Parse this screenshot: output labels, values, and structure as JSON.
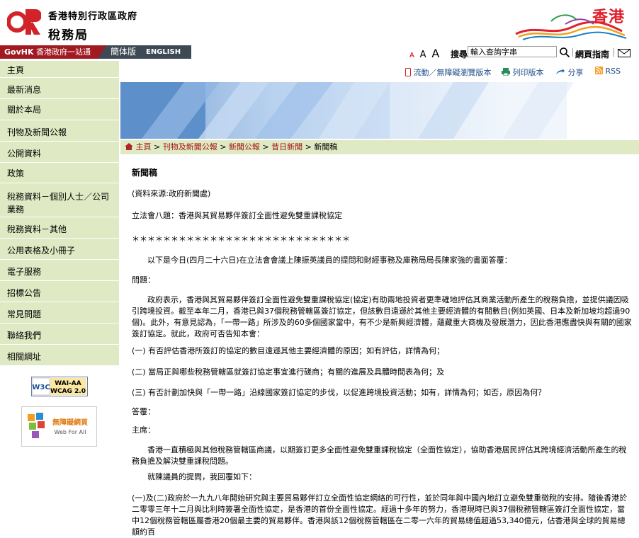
{
  "header": {
    "gov_name": "香港特別行政區政府",
    "dept_name": "稅務局",
    "brand_text": "香港"
  },
  "topbar": {
    "govhk_prefix": "GovHK",
    "govhk_text": "香港政府一站通",
    "lang_sc": "簡体版",
    "lang_en": "ENGLISH",
    "font_small": "A",
    "font_mid": "A",
    "font_large": "A",
    "search_label": "搜尋",
    "search_value": "輸入查詢字串",
    "sitemap": "網頁指南"
  },
  "sidebar": {
    "items": [
      {
        "label": "主頁"
      },
      {
        "label": "最新消息"
      },
      {
        "label": "關於本局"
      },
      {
        "label": "刊物及新聞公報"
      },
      {
        "label": "公開資料"
      },
      {
        "label": "政策"
      },
      {
        "label": "稅務資料－個別人士／公司業務"
      },
      {
        "label": "稅務資料－其他"
      },
      {
        "label": "公用表格及小冊子"
      },
      {
        "label": "電子服務"
      },
      {
        "label": "招標公告"
      },
      {
        "label": "常見問題"
      },
      {
        "label": "聯絡我們"
      },
      {
        "label": "相關網址"
      }
    ],
    "w3c_text": "W3C",
    "wai_text": "WAI-AA",
    "wcag_text": "WCAG 2.0",
    "wfa_text1": "無障礙網頁",
    "wfa_text2": "Web For All"
  },
  "tools": {
    "mobile": "流動／無障礙瀏覽版本",
    "print": "列印版本",
    "share": "分享",
    "rss": "RSS"
  },
  "breadcrumb": {
    "home": "主頁",
    "c1": "刊物及新聞公報",
    "c2": "新聞公報",
    "c3": "昔日新聞",
    "current": "新聞稿"
  },
  "article": {
    "title": "新聞稿",
    "source": "(資料來源:政府新聞處)",
    "heading": "立法會八題：香港與其貿易夥伴簽訂全面性避免雙重課稅協定",
    "stars": "＊＊＊＊＊＊＊＊＊＊＊＊＊＊＊＊＊＊＊＊＊＊＊＊＊＊＊＊",
    "intro": "以下是今日(四月二十六日)在立法會會議上陳振英議員的提問和財經事務及庫務局局長陳家強的書面答覆：",
    "q_label": "問題：",
    "q_body": "政府表示，香港與其貿易夥伴簽訂全面性避免雙重課稅協定(協定)有助兩地投資者更準確地評估其商業活動所產生的稅務負擔，並提供議因吸引跨境投資。截至本年二月，香港已與37個稅務管轄區簽訂協定，但該數目遠遜於其他主要經濟體的有關數目(例如英國、日本及新加坡均超過90個)。此外，有意見認為，「一帶一路」所涉及的60多個國家當中，有不少是新興經濟體，蘊藏重大商機及發展潛力，因此香港應盡快與有關的國家簽訂協定。就此，政府可否告知本會：",
    "q1": "(一) 有否評估香港所簽訂的協定的數目遠遜其他主要經濟體的原因；如有評估，詳情為何；",
    "q2": "(二) 當局正與哪些稅務管轄區就簽訂協定事宜進行磋商；有關的進展及具體時間表為何；及",
    "q3": "(三) 有否計劃加快與「一帶一路」沿線國家簽訂協定的步伐，以促進跨境投資活動；如有，詳情為何；如否，原因為何？",
    "a_label": "答覆：",
    "chair": "主席：",
    "a_body": "香港一直積極與其他稅務管轄區商議，以期簽訂更多全面性避免雙重課稅協定（全面性協定），協助香港居民評估其跨境經濟活動所產生的稅務負擔及解決雙重課稅問題。",
    "reply_intro": "就陳議員的提問，我回覆如下：",
    "a1": "(一)及(二)政府於一九九八年開始研究與主要貿易夥伴訂立全面性協定網絡的可行性，並於同年與中國內地訂立避免雙重徵稅的安排。隨後香港於二零零三年十二月與比利時簽署全面性協定，是香港的首份全面性協定。經過十多年的努力，香港現時已與37個稅務管轄區簽訂全面性協定，當中12個稅務管轄區屬香港20個最主要的貿易夥伴。香港與該12個稅務管轄區在二零一六年的貿易總值超過53,340億元，佔香港與全球的貿易總額約百"
  }
}
